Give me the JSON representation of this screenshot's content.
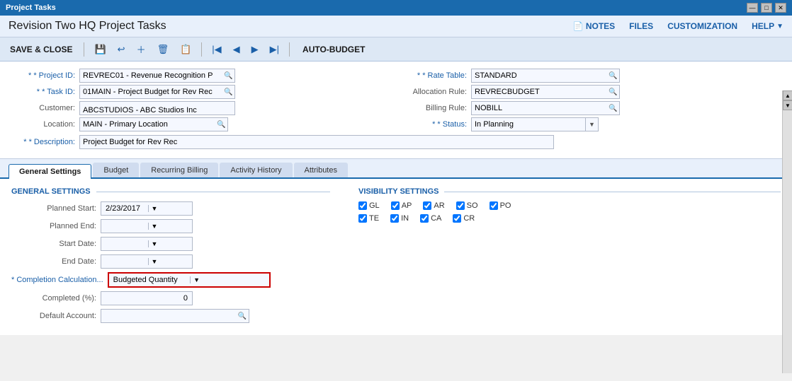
{
  "titleBar": {
    "title": "Project Tasks",
    "controls": [
      "—",
      "□",
      "✕"
    ]
  },
  "header": {
    "title": "Revision Two HQ  Project Tasks",
    "actions": [
      {
        "id": "notes",
        "label": "NOTES",
        "icon": "📄"
      },
      {
        "id": "files",
        "label": "FILES"
      },
      {
        "id": "customization",
        "label": "CUSTOMIZATION"
      },
      {
        "id": "help",
        "label": "HELP"
      }
    ]
  },
  "toolbar": {
    "saveClose": "SAVE & CLOSE",
    "autoBudget": "AUTO-BUDGET",
    "buttons": [
      "save",
      "undo",
      "add",
      "delete",
      "copy",
      "first",
      "prev",
      "next",
      "last"
    ]
  },
  "form": {
    "projectId": {
      "label": "* Project ID:",
      "value": "REVREC01 - Revenue Recognition P"
    },
    "taskId": {
      "label": "* Task ID:",
      "value": "01MAIN - Project Budget for Rev Rec"
    },
    "customer": {
      "label": "Customer:",
      "value": "ABCSTUDIOS - ABC Studios Inc"
    },
    "location": {
      "label": "Location:",
      "value": "MAIN - Primary Location"
    },
    "description": {
      "label": "* Description:",
      "value": "Project Budget for Rev Rec"
    },
    "rateTable": {
      "label": "* Rate Table:",
      "value": "STANDARD"
    },
    "allocationRule": {
      "label": "Allocation Rule:",
      "value": "REVRECBUDGET"
    },
    "billingRule": {
      "label": "Billing Rule:",
      "value": "NOBILL"
    },
    "status": {
      "label": "* Status:",
      "value": "In Planning"
    }
  },
  "tabs": [
    {
      "id": "general-settings",
      "label": "General Settings",
      "active": true
    },
    {
      "id": "budget",
      "label": "Budget",
      "active": false
    },
    {
      "id": "recurring-billing",
      "label": "Recurring Billing",
      "active": false
    },
    {
      "id": "activity-history",
      "label": "Activity History",
      "active": false
    },
    {
      "id": "attributes",
      "label": "Attributes",
      "active": false
    }
  ],
  "generalSettings": {
    "sectionTitle": "GENERAL SETTINGS",
    "fields": {
      "plannedStart": {
        "label": "Planned Start:",
        "value": "2/23/2017"
      },
      "plannedEnd": {
        "label": "Planned End:",
        "value": ""
      },
      "startDate": {
        "label": "Start Date:",
        "value": ""
      },
      "endDate": {
        "label": "End Date:",
        "value": ""
      },
      "completionCalc": {
        "label": "* Completion Calculation...",
        "value": "Budgeted Quantity"
      },
      "completedPct": {
        "label": "Completed (%):",
        "value": "0"
      },
      "defaultAccount": {
        "label": "Default Account:",
        "value": ""
      }
    }
  },
  "visibilitySettings": {
    "sectionTitle": "VISIBILITY SETTINGS",
    "checkboxRows": [
      [
        {
          "id": "gl",
          "label": "GL",
          "checked": true
        },
        {
          "id": "ap",
          "label": "AP",
          "checked": true
        },
        {
          "id": "ar",
          "label": "AR",
          "checked": true
        },
        {
          "id": "so",
          "label": "SO",
          "checked": true
        },
        {
          "id": "po",
          "label": "PO",
          "checked": true
        }
      ],
      [
        {
          "id": "te",
          "label": "TE",
          "checked": true
        },
        {
          "id": "in",
          "label": "IN",
          "checked": true
        },
        {
          "id": "ca",
          "label": "CA",
          "checked": true
        },
        {
          "id": "cr",
          "label": "CR",
          "checked": true
        }
      ]
    ]
  }
}
